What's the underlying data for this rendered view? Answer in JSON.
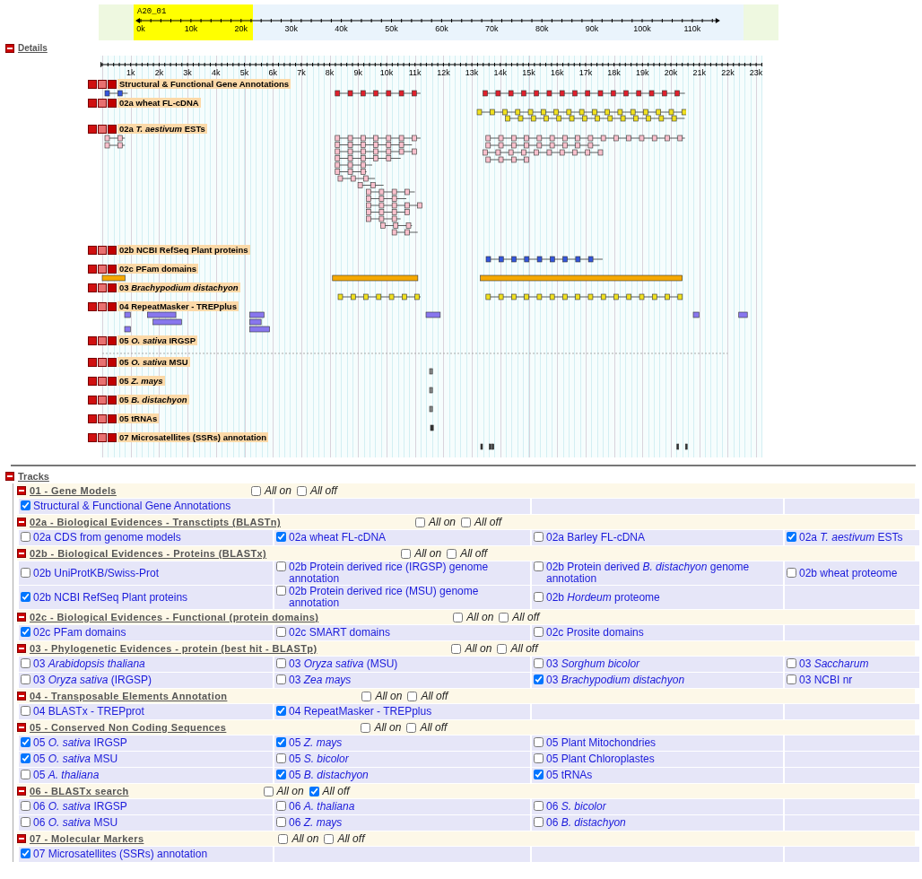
{
  "overview": {
    "label": "A20_01",
    "ticks": [
      "0k",
      "10k",
      "20k",
      "30k",
      "40k",
      "50k",
      "60k",
      "70k",
      "80k",
      "90k",
      "100k",
      "110k"
    ]
  },
  "details": {
    "title": "Details",
    "ticks": [
      "1k",
      "2k",
      "3k",
      "4k",
      "5k",
      "6k",
      "7k",
      "8k",
      "9k",
      "10k",
      "11k",
      "12k",
      "13k",
      "14k",
      "15k",
      "16k",
      "17k",
      "18k",
      "19k",
      "20k",
      "21k",
      "22k",
      "23k"
    ],
    "tracks": [
      {
        "label": "Structural & Functional Gene Annotations"
      },
      {
        "label": "02a wheat FL-cDNA"
      },
      {
        "label": "02a *T. aestivum* ESTs"
      },
      {
        "label": "02b NCBI RefSeq Plant proteins"
      },
      {
        "label": "02c PFam domains"
      },
      {
        "label": "03 *Brachypodium distachyon*"
      },
      {
        "label": "04 RepeatMasker - TREPplus"
      },
      {
        "label": "05 *O. sativa* IRGSP"
      },
      {
        "label": "05 *O. sativa* MSU"
      },
      {
        "label": "05 *Z. mays*"
      },
      {
        "label": "05 *B. distachyon*"
      },
      {
        "label": "05 tRNAs"
      },
      {
        "label": "07 Microsatellites (SSRs) annotation"
      }
    ]
  },
  "tracks_panel": {
    "title": "Tracks",
    "sections": [
      {
        "title": "01 - Gene Models",
        "all_on_label": "All on",
        "all_on": false,
        "all_off_label": "All off",
        "all_off": false,
        "rows": [
          [
            {
              "label": "Structural & Functional Gene Annotations",
              "checked": true
            }
          ]
        ]
      },
      {
        "title": "02a - Biological Evidences - Transctipts (BLASTn)",
        "all_on_label": "All on",
        "all_on": false,
        "all_off_label": "All off",
        "all_off": false,
        "rows": [
          [
            {
              "label": "02a CDS from genome models",
              "checked": false
            },
            {
              "label": "02a wheat FL-cDNA",
              "checked": true
            },
            {
              "label": "02a Barley FL-cDNA",
              "checked": false
            },
            {
              "label": "02a *T. aestivum* ESTs",
              "checked": true
            }
          ]
        ]
      },
      {
        "title": "02b - Biological Evidences - Proteins (BLASTx)",
        "all_on_label": "All on",
        "all_on": false,
        "all_off_label": "All off",
        "all_off": false,
        "rows": [
          [
            {
              "label": "02b UniProtKB/Swiss-Prot",
              "checked": false
            },
            {
              "label": "02b Protein derived rice (IRGSP) genome annotation",
              "checked": false
            },
            {
              "label": "02b Protein derived *B. distachyon* genome annotation",
              "checked": false
            },
            {
              "label": "02b wheat proteome",
              "checked": false
            }
          ],
          [
            {
              "label": "02b NCBI RefSeq Plant proteins",
              "checked": true
            },
            {
              "label": "02b Protein derived rice (MSU) genome annotation",
              "checked": false
            },
            {
              "label": "02b *Hordeum* proteome",
              "checked": false
            }
          ]
        ]
      },
      {
        "title": "02c - Biological Evidences - Functional (protein domains)",
        "all_on_label": "All on",
        "all_on": false,
        "all_off_label": "All off",
        "all_off": false,
        "rows": [
          [
            {
              "label": "02c PFam domains",
              "checked": true
            },
            {
              "label": "02c SMART domains",
              "checked": false
            },
            {
              "label": "02c Prosite domains",
              "checked": false
            }
          ]
        ]
      },
      {
        "title": "03 - Phylogenetic Evidences - protein (best hit - BLASTp)",
        "all_on_label": "All on",
        "all_on": false,
        "all_off_label": "All off",
        "all_off": false,
        "rows": [
          [
            {
              "label": "03 *Arabidopsis thaliana*",
              "checked": false
            },
            {
              "label": "03 *Oryza sativa* (MSU)",
              "checked": false
            },
            {
              "label": "03 *Sorghum bicolor*",
              "checked": false
            },
            {
              "label": "03 *Saccharum*",
              "checked": false
            }
          ],
          [
            {
              "label": "03 *Oryza sativa* (IRGSP)",
              "checked": false
            },
            {
              "label": "03 *Zea mays*",
              "checked": false
            },
            {
              "label": "03 *Brachypodium distachyon*",
              "checked": true
            },
            {
              "label": "03 NCBI nr",
              "checked": false
            }
          ]
        ]
      },
      {
        "title": "04 - Transposable Elements Annotation",
        "all_on_label": "All on",
        "all_on": false,
        "all_off_label": "All off",
        "all_off": false,
        "rows": [
          [
            {
              "label": "04 BLASTx - TREPprot",
              "checked": false
            },
            {
              "label": "04 RepeatMasker - TREPplus",
              "checked": true
            }
          ]
        ]
      },
      {
        "title": "05 - Conserved Non Coding Sequences",
        "all_on_label": "All on",
        "all_on": false,
        "all_off_label": "All off",
        "all_off": false,
        "rows": [
          [
            {
              "label": "05 *O. sativa* IRGSP",
              "checked": true
            },
            {
              "label": "05 *Z. mays*",
              "checked": true
            },
            {
              "label": "05 Plant Mitochondries",
              "checked": false
            }
          ],
          [
            {
              "label": "05 *O. sativa* MSU",
              "checked": true
            },
            {
              "label": "05 *S. bicolor*",
              "checked": false
            },
            {
              "label": "05 Plant Chloroplastes",
              "checked": false
            }
          ],
          [
            {
              "label": "05 *A. thaliana*",
              "checked": false
            },
            {
              "label": "05 *B. distachyon*",
              "checked": true
            },
            {
              "label": "05 tRNAs",
              "checked": true
            }
          ]
        ]
      },
      {
        "title": "06 - BLASTx search",
        "all_on_label": "All on",
        "all_on": false,
        "all_off_label": "All off",
        "all_off": true,
        "rows": [
          [
            {
              "label": "06 *O. sativa* IRGSP",
              "checked": false
            },
            {
              "label": "06 *A. thaliana*",
              "checked": false
            },
            {
              "label": "06 *S. bicolor*",
              "checked": false
            }
          ],
          [
            {
              "label": "06 *O. sativa* MSU",
              "checked": false
            },
            {
              "label": "06 *Z. mays*",
              "checked": false
            },
            {
              "label": "06 *B. distachyon*",
              "checked": false
            }
          ]
        ]
      },
      {
        "title": "07 - Molecular Markers",
        "all_on_label": "All on",
        "all_on": false,
        "all_off_label": "All off",
        "all_off": false,
        "rows": [
          [
            {
              "label": "07 Microsatellites (SSRs) annotation",
              "checked": true
            }
          ]
        ]
      }
    ]
  }
}
